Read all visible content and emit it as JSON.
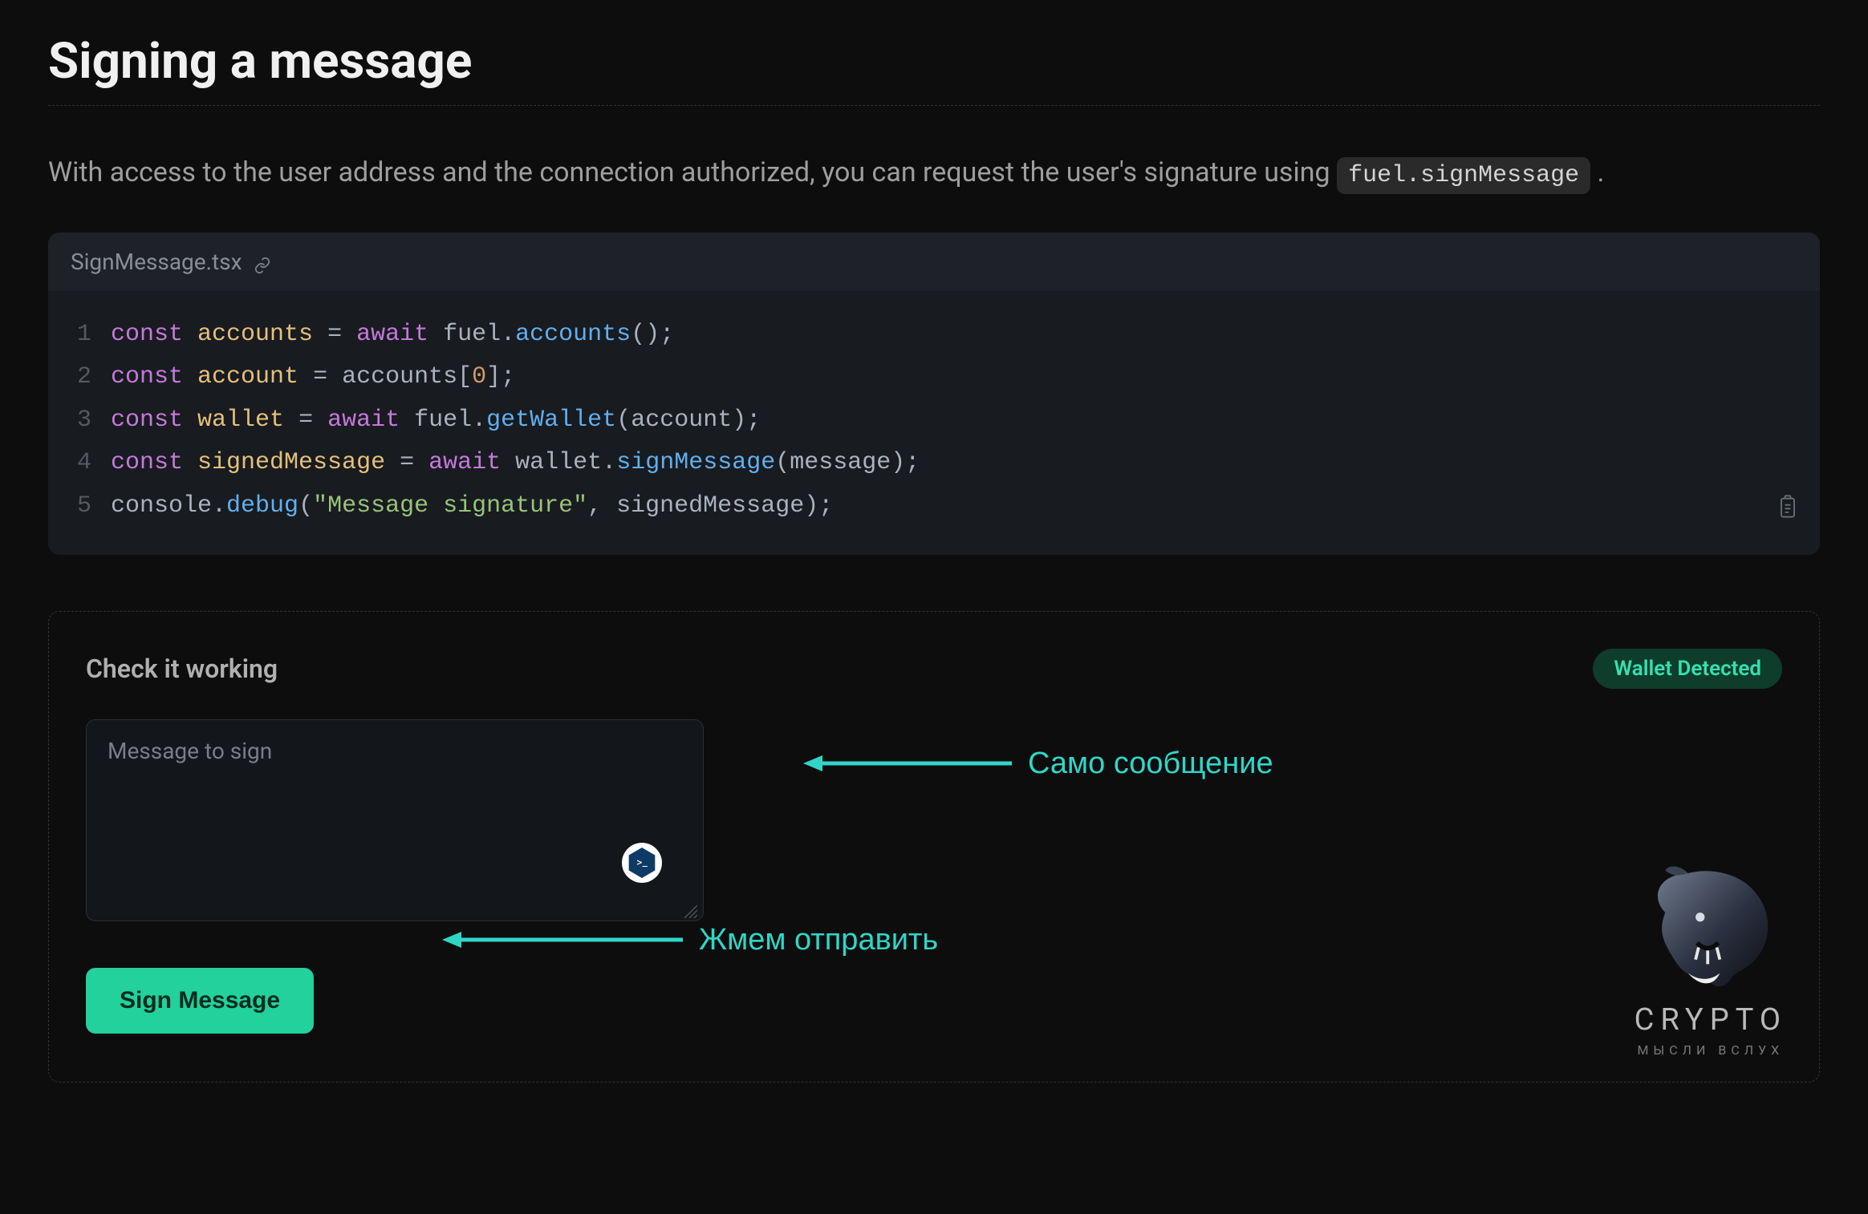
{
  "header": {
    "title": "Signing a message"
  },
  "intro": {
    "text": "With access to the user address and the connection authorized, you can request the user's signature using ",
    "code": "fuel.signMessage",
    "suffix": " ."
  },
  "code": {
    "filename": "SignMessage.tsx",
    "lines": [
      {
        "num": "1",
        "tokens": [
          {
            "cls": "tok-kw",
            "t": "const"
          },
          {
            "cls": "tok-default",
            "t": " "
          },
          {
            "cls": "tok-var",
            "t": "accounts"
          },
          {
            "cls": "tok-default",
            "t": " "
          },
          {
            "cls": "tok-punc",
            "t": "="
          },
          {
            "cls": "tok-default",
            "t": " "
          },
          {
            "cls": "tok-kw",
            "t": "await"
          },
          {
            "cls": "tok-default",
            "t": " fuel"
          },
          {
            "cls": "tok-punc",
            "t": "."
          },
          {
            "cls": "tok-fn",
            "t": "accounts"
          },
          {
            "cls": "tok-punc",
            "t": "();"
          }
        ]
      },
      {
        "num": "2",
        "tokens": [
          {
            "cls": "tok-kw",
            "t": "const"
          },
          {
            "cls": "tok-default",
            "t": " "
          },
          {
            "cls": "tok-var",
            "t": "account"
          },
          {
            "cls": "tok-default",
            "t": " "
          },
          {
            "cls": "tok-punc",
            "t": "="
          },
          {
            "cls": "tok-default",
            "t": " accounts"
          },
          {
            "cls": "tok-punc",
            "t": "["
          },
          {
            "cls": "tok-num",
            "t": "0"
          },
          {
            "cls": "tok-punc",
            "t": "];"
          }
        ]
      },
      {
        "num": "3",
        "tokens": [
          {
            "cls": "tok-kw",
            "t": "const"
          },
          {
            "cls": "tok-default",
            "t": " "
          },
          {
            "cls": "tok-var",
            "t": "wallet"
          },
          {
            "cls": "tok-default",
            "t": " "
          },
          {
            "cls": "tok-punc",
            "t": "="
          },
          {
            "cls": "tok-default",
            "t": " "
          },
          {
            "cls": "tok-kw",
            "t": "await"
          },
          {
            "cls": "tok-default",
            "t": " fuel"
          },
          {
            "cls": "tok-punc",
            "t": "."
          },
          {
            "cls": "tok-fn",
            "t": "getWallet"
          },
          {
            "cls": "tok-punc",
            "t": "("
          },
          {
            "cls": "tok-default",
            "t": "account"
          },
          {
            "cls": "tok-punc",
            "t": ");"
          }
        ]
      },
      {
        "num": "4",
        "tokens": [
          {
            "cls": "tok-kw",
            "t": "const"
          },
          {
            "cls": "tok-default",
            "t": " "
          },
          {
            "cls": "tok-var",
            "t": "signedMessage"
          },
          {
            "cls": "tok-default",
            "t": " "
          },
          {
            "cls": "tok-punc",
            "t": "="
          },
          {
            "cls": "tok-default",
            "t": " "
          },
          {
            "cls": "tok-kw",
            "t": "await"
          },
          {
            "cls": "tok-default",
            "t": " wallet"
          },
          {
            "cls": "tok-punc",
            "t": "."
          },
          {
            "cls": "tok-fn",
            "t": "signMessage"
          },
          {
            "cls": "tok-punc",
            "t": "("
          },
          {
            "cls": "tok-default",
            "t": "message"
          },
          {
            "cls": "tok-punc",
            "t": ");"
          }
        ]
      },
      {
        "num": "5",
        "tokens": [
          {
            "cls": "tok-default",
            "t": "console"
          },
          {
            "cls": "tok-punc",
            "t": "."
          },
          {
            "cls": "tok-fn",
            "t": "debug"
          },
          {
            "cls": "tok-punc",
            "t": "("
          },
          {
            "cls": "tok-str",
            "t": "\"Message signature\""
          },
          {
            "cls": "tok-punc",
            "t": ","
          },
          {
            "cls": "tok-default",
            "t": " signedMessage"
          },
          {
            "cls": "tok-punc",
            "t": ");"
          }
        ]
      }
    ]
  },
  "example": {
    "title": "Check it working",
    "badge": "Wallet Detected",
    "placeholder": "Message to sign",
    "button": "Sign Message",
    "input_value": ""
  },
  "annotations": {
    "anno1": "Само сообщение",
    "anno2": "Жмем отправить"
  },
  "watermark": {
    "title": "CRYPTO",
    "sub": "МЫСЛИ ВСЛУХ"
  },
  "colors": {
    "accent": "#22d19b",
    "badge_bg": "#0e3d2c",
    "anno": "#2fd6c8"
  }
}
